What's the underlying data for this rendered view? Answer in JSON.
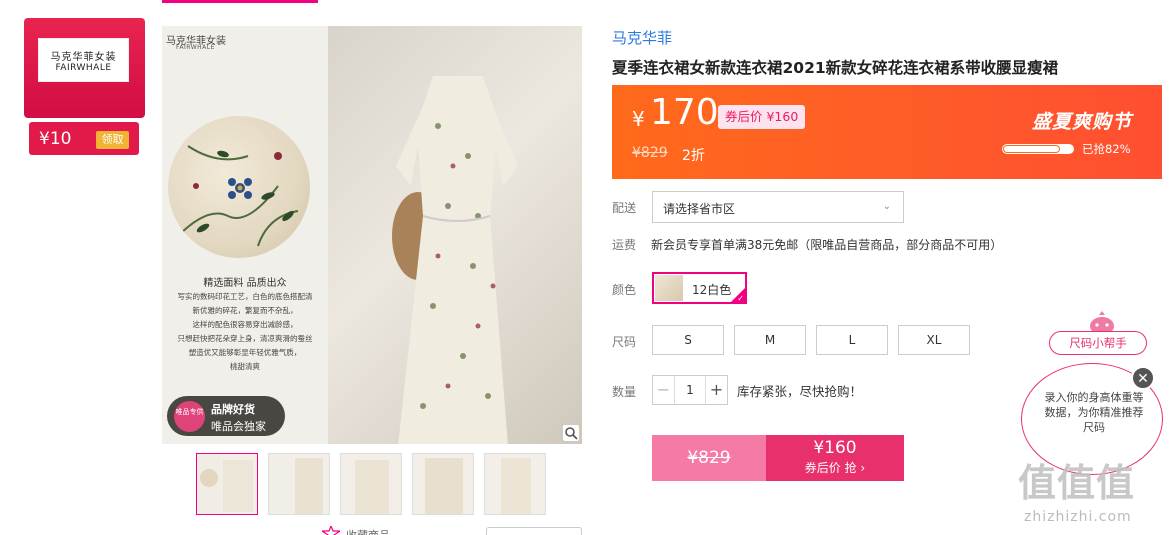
{
  "brand_coupon": {
    "logo_cn": "马克华菲女装",
    "logo_en": "FAIRWHALE",
    "amount": "¥10",
    "claim_label": "领取"
  },
  "main_image": {
    "brand_cn": "马克华菲女装",
    "brand_en": "FAIRWHALE",
    "fabric_title": "精选面料 品质出众",
    "fabric_desc": [
      "写实的数码印花工艺，白色的底色搭配清",
      "新优雅的碎花，繁复而不杂乱，",
      "这样的配色很容易穿出减龄感，",
      "只想赶快把花朵穿上身，清凉爽滑的蚕丝",
      "塑造优又能够彰显年轻优雅气质，",
      "桃甜清爽"
    ],
    "badge_circle": "唯品专供",
    "badge_line1": "品牌好货",
    "badge_line2": "唯品会独家"
  },
  "product": {
    "brand": "马克华菲",
    "title": "夏季连衣裙女新款连衣裙2021新款女碎花连衣裙系带收腰显瘦裙"
  },
  "price": {
    "currency": "¥",
    "value": "170",
    "after_coupon": "券后价 ¥160",
    "original": "¥829",
    "discount": "2折",
    "event": "盛夏爽购节",
    "sold_progress": 0.82,
    "sold_text": "已抢82%"
  },
  "labels": {
    "delivery": "配送",
    "shipping": "运费",
    "color": "颜色",
    "size": "尺码",
    "quantity": "数量"
  },
  "delivery": {
    "placeholder": "请选择省市区"
  },
  "shipping": {
    "text": "新会员专享首单满38元免邮（限唯品自营商品，部分商品不可用）"
  },
  "color": {
    "selected": "12白色"
  },
  "sizes": [
    "S",
    "M",
    "L",
    "XL"
  ],
  "quantity": {
    "value": "1",
    "minus": "−",
    "plus": "+",
    "stock_note": "库存紧张，尽快抢购！"
  },
  "buy": {
    "original": "¥829",
    "coupon_price": "¥160",
    "coupon_label": "券后价 抢 ›"
  },
  "size_helper": {
    "tag": "尺码小帮手",
    "text": "录入你的身高体重等数据，为你精准推荐尺码",
    "close": "✕"
  },
  "footer": {
    "favorite": "收藏商品"
  },
  "watermark": {
    "main": "值值值",
    "sub": "zhizhizhi.com"
  },
  "colors": {
    "accent": "#f10180",
    "price_bg": "#ff5a2a",
    "buy": "#e8306d",
    "link": "#2a7ae2"
  }
}
